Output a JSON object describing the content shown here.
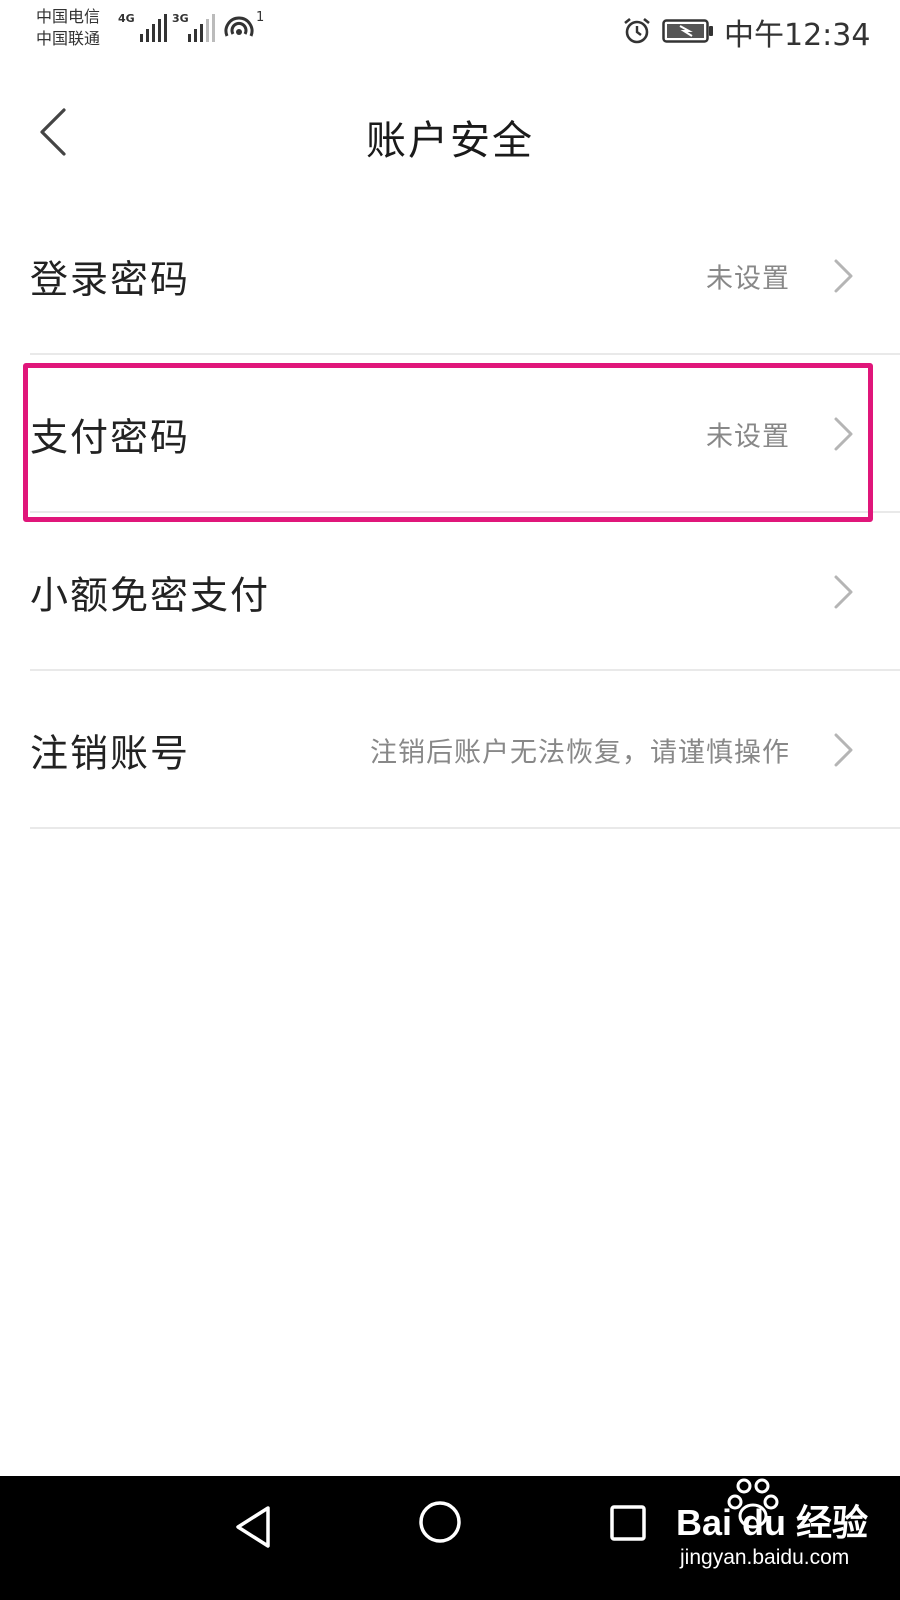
{
  "status_bar": {
    "carrier_1": "中国电信",
    "carrier_2": "中国联通",
    "network_1": "4G",
    "network_2": "3G",
    "hotspot_count": "1",
    "time": "中午12:34",
    "icons": [
      "signal-icon",
      "wifi-hotspot-icon",
      "alarm-icon",
      "battery-charging-icon"
    ]
  },
  "header": {
    "title": "账户安全",
    "back_icon": "chevron-left-icon"
  },
  "settings": [
    {
      "label": "登录密码",
      "value": "未设置"
    },
    {
      "label": "支付密码",
      "value": "未设置",
      "highlighted": true
    },
    {
      "label": "小额免密支付",
      "value": ""
    },
    {
      "label": "注销账号",
      "value": "注销后账户无法恢复，请谨慎操作"
    }
  ],
  "highlight_color": "#e0167a",
  "nav_bar": {
    "icons": [
      "nav-back-icon",
      "nav-home-icon",
      "nav-recent-icon"
    ]
  },
  "watermark": {
    "brand": "Bai du 经验",
    "url": "jingyan.baidu.com"
  }
}
